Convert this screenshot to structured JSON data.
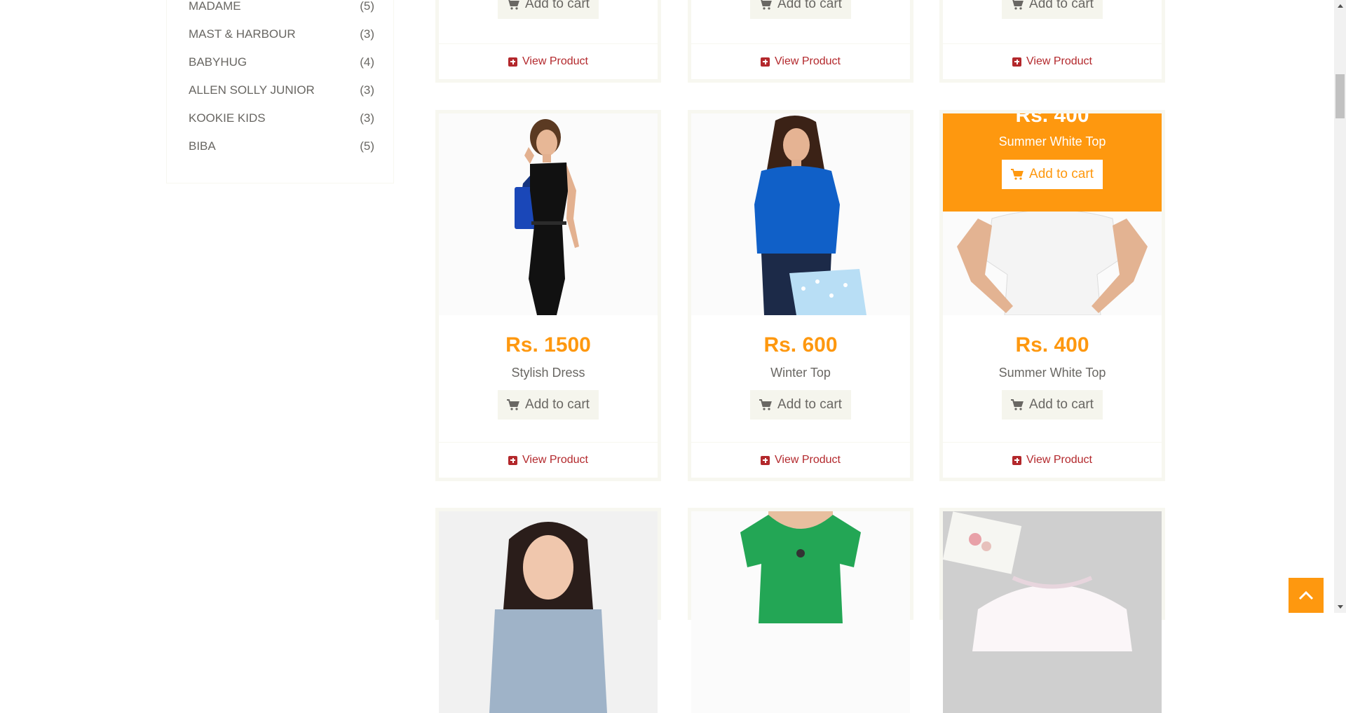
{
  "colors": {
    "accent": "#FE980F",
    "link": "#B3282C",
    "text": "#696763",
    "button_bg": "#F5F5ED"
  },
  "brands": [
    {
      "name": "MADAME",
      "count": "(5)"
    },
    {
      "name": "MAST & HARBOUR",
      "count": "(3)"
    },
    {
      "name": "BABYHUG",
      "count": "(4)"
    },
    {
      "name": "ALLEN SOLLY JUNIOR",
      "count": "(3)"
    },
    {
      "name": "KOOKIE KIDS",
      "count": "(3)"
    },
    {
      "name": "BIBA",
      "count": "(5)"
    }
  ],
  "common": {
    "add_to_cart": "Add to cart",
    "view_product": "View Product"
  },
  "products": [
    {
      "price": "Rs. 1500",
      "name": "Stylish Dress"
    },
    {
      "price": "Rs. 600",
      "name": "Winter Top"
    },
    {
      "price": "Rs. 400",
      "name": "Summer White Top"
    }
  ],
  "overlay": {
    "price": "Rs. 400",
    "name": "Summer White Top",
    "button": "Add to cart"
  },
  "icons": {
    "cart": "shopping-cart-icon",
    "plus": "plus-square-icon",
    "top": "chevron-up-icon"
  }
}
